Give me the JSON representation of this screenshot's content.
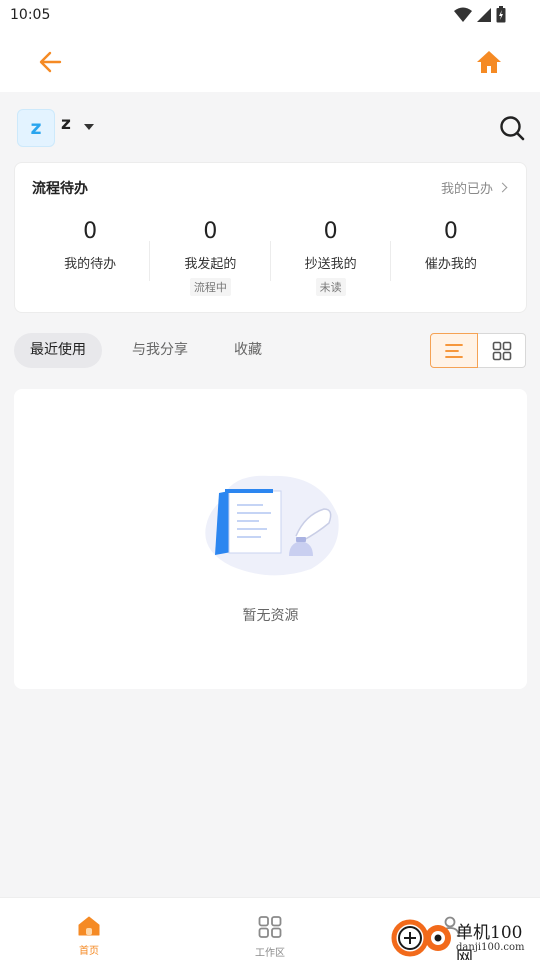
{
  "status_bar": {
    "time": "10:05"
  },
  "top_bar": {
    "back_icon": "arrow-left-icon",
    "home_icon": "home-icon",
    "accent_color": "#f58a24"
  },
  "user": {
    "avatar_letter": "z",
    "name": "z"
  },
  "task_card": {
    "title": "流程待办",
    "done_link": "我的已办",
    "stats": [
      {
        "value": "0",
        "label": "我的待办",
        "sub": ""
      },
      {
        "value": "0",
        "label": "我发起的",
        "sub": "流程中"
      },
      {
        "value": "0",
        "label": "抄送我的",
        "sub": "未读"
      },
      {
        "value": "0",
        "label": "催办我的",
        "sub": ""
      }
    ]
  },
  "tabs": [
    {
      "label": "最近使用",
      "active": true
    },
    {
      "label": "与我分享",
      "active": false
    },
    {
      "label": "收藏",
      "active": false
    }
  ],
  "view_toggle": {
    "selected": "list",
    "options": [
      "list-icon",
      "grid-icon"
    ]
  },
  "empty_state": {
    "text": "暂无资源"
  },
  "bottom_nav": [
    {
      "label": "首页",
      "icon": "home-icon",
      "active": true
    },
    {
      "label": "工作区",
      "icon": "grid-icon",
      "active": false
    },
    {
      "label": "",
      "icon": "person-icon",
      "active": false
    }
  ],
  "watermark": {
    "brand": "单机100网",
    "url": "danji100.com"
  }
}
